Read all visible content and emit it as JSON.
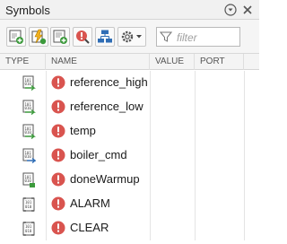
{
  "panel": {
    "title": "Symbols"
  },
  "toolbar": {
    "tools": [
      {
        "icon": "add-symbol-icon"
      },
      {
        "icon": "resolve-undefined-icon"
      },
      {
        "icon": "add-data-icon"
      },
      {
        "icon": "inspect-icon"
      },
      {
        "icon": "hierarchy-icon"
      },
      {
        "icon": "settings-dropdown-icon"
      }
    ],
    "filter_placeholder": "filter"
  },
  "columns": [
    "TYPE",
    "NAME",
    "VALUE",
    "PORT"
  ],
  "symbols": [
    {
      "name": "reference_high",
      "type_icon": "data-input-icon",
      "status": "error"
    },
    {
      "name": "reference_low",
      "type_icon": "data-input-icon",
      "status": "error"
    },
    {
      "name": "temp",
      "type_icon": "data-input-icon",
      "status": "error"
    },
    {
      "name": "boiler_cmd",
      "type_icon": "data-output-icon",
      "status": "error"
    },
    {
      "name": "doneWarmup",
      "type_icon": "data-local-icon",
      "status": "error"
    },
    {
      "name": "ALARM",
      "type_icon": "data-constant-icon",
      "status": "error"
    },
    {
      "name": "CLEAR",
      "type_icon": "data-constant-icon",
      "status": "error"
    }
  ],
  "colors": {
    "error": "#d9544f",
    "accent_blue": "#2f6db5",
    "add_green": "#3c9a3c"
  }
}
